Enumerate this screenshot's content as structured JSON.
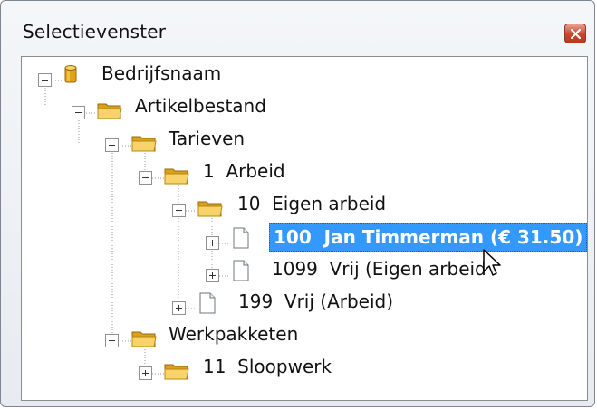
{
  "window": {
    "title": "Selectievenster",
    "close_icon": "close-icon",
    "colors": {
      "selection": "#3399ff",
      "folder": "#f2c14e",
      "database": "#e0a21a"
    }
  },
  "tree": {
    "root": {
      "label": "Bedrijfsnaam",
      "icon": "database-icon",
      "state": "expanded"
    },
    "artikelbestand": {
      "label": "Artikelbestand",
      "icon": "folder-icon",
      "state": "expanded"
    },
    "tarieven": {
      "label": "Tarieven",
      "icon": "folder-icon",
      "state": "expanded"
    },
    "arbeid": {
      "label": "1  Arbeid",
      "icon": "folder-icon",
      "state": "expanded"
    },
    "eigen_arbeid": {
      "label": "10  Eigen arbeid",
      "icon": "folder-icon",
      "state": "expanded"
    },
    "jan_timmerman": {
      "label": "100  Jan Timmerman (€ 31.50)",
      "icon": "document-icon",
      "state": "collapsed",
      "selected": true
    },
    "vrij_eigen_arbeid": {
      "label": "1099  Vrij (Eigen arbeid",
      "icon": "document-icon",
      "state": "collapsed"
    },
    "vrij_arbeid": {
      "label": "199  Vrij (Arbeid)",
      "icon": "document-icon",
      "state": "collapsed"
    },
    "werkpakketen": {
      "label": "Werkpakketen",
      "icon": "folder-icon",
      "state": "expanded"
    },
    "sloopwerk": {
      "label": "11  Sloopwerk",
      "icon": "folder-icon",
      "state": "collapsed"
    }
  }
}
